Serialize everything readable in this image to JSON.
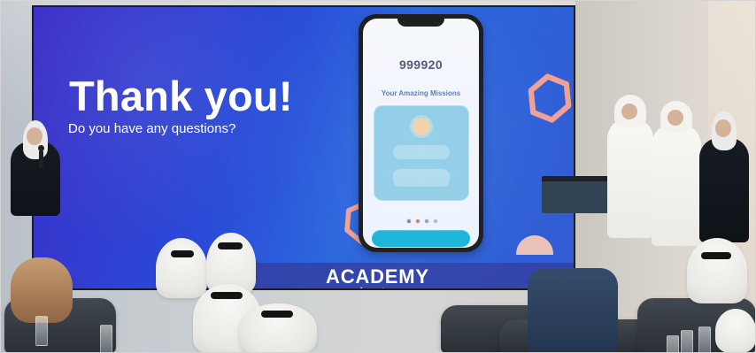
{
  "slide": {
    "title": "Thank you!",
    "subtitle": "Do you have any questions?",
    "academy_title": "ACADEMY",
    "academy_script": "raduation"
  },
  "phone": {
    "score": "999920",
    "missions_title": "Your Amazing Missions"
  }
}
